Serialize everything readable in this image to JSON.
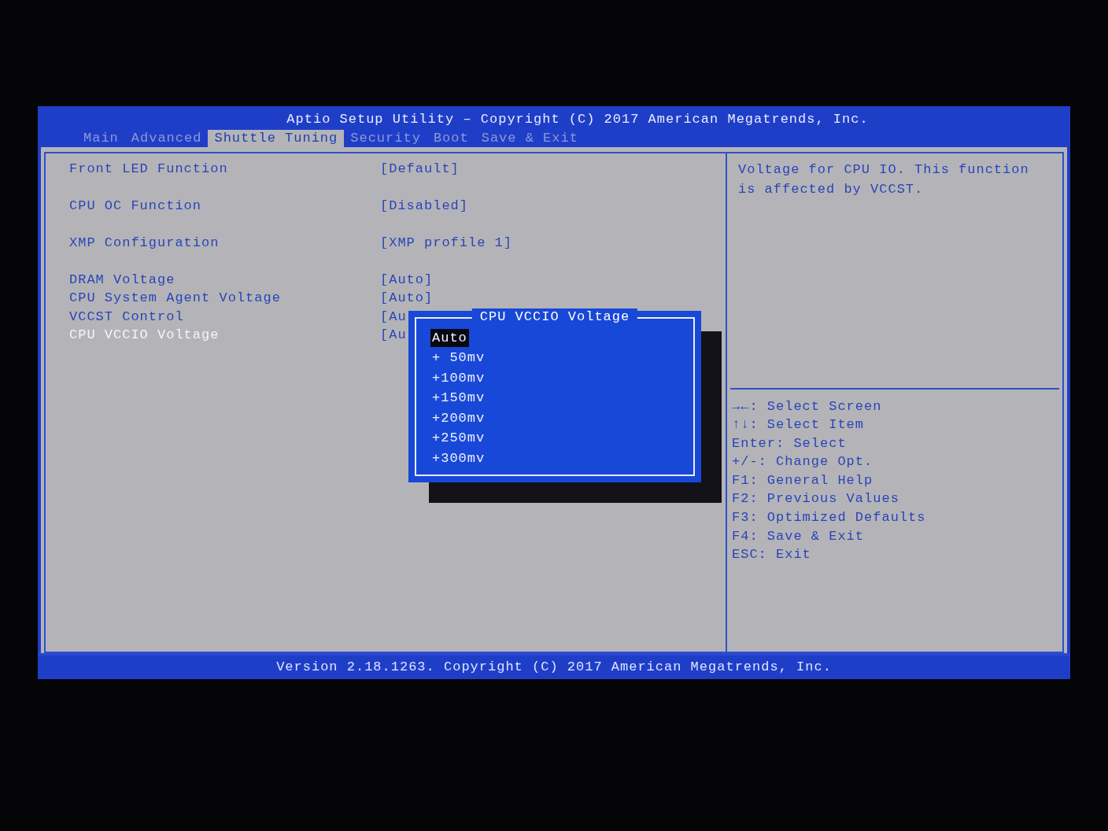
{
  "title": "Aptio Setup Utility – Copyright (C) 2017 American Megatrends, Inc.",
  "tabs": [
    {
      "label": "Main",
      "selected": false
    },
    {
      "label": "Advanced",
      "selected": false
    },
    {
      "label": "Shuttle Tuning",
      "selected": true
    },
    {
      "label": "Security",
      "selected": false
    },
    {
      "label": "Boot",
      "selected": false
    },
    {
      "label": "Save & Exit",
      "selected": false
    }
  ],
  "setting_groups": [
    [
      {
        "label": "Front LED Function",
        "value": "[Default]",
        "selected": false
      }
    ],
    [
      {
        "label": "CPU OC Function",
        "value": "[Disabled]",
        "selected": false
      }
    ],
    [
      {
        "label": "XMP Configuration",
        "value": "[XMP profile 1]",
        "selected": false
      }
    ],
    [
      {
        "label": "DRAM Voltage",
        "value": "[Auto]",
        "selected": false
      },
      {
        "label": "CPU System Agent Voltage",
        "value": "[Auto]",
        "selected": false
      },
      {
        "label": "VCCST Control",
        "value": "[Au",
        "selected": false
      },
      {
        "label": "CPU VCCIO Voltage",
        "value": "[Au",
        "selected": true
      }
    ]
  ],
  "popup": {
    "title": "CPU VCCIO Voltage",
    "options": [
      {
        "label": "Auto",
        "selected": true
      },
      {
        "label": "+ 50mv",
        "selected": false
      },
      {
        "label": "+100mv",
        "selected": false
      },
      {
        "label": "+150mv",
        "selected": false
      },
      {
        "label": "+200mv",
        "selected": false
      },
      {
        "label": "+250mv",
        "selected": false
      },
      {
        "label": "+300mv",
        "selected": false
      }
    ]
  },
  "help": {
    "description": "Voltage for CPU IO. This function is affected by VCCST.",
    "keys": [
      "→←: Select Screen",
      "↑↓: Select Item",
      "Enter: Select",
      "+/-: Change Opt.",
      "F1: General Help",
      "F2: Previous Values",
      "F3: Optimized Defaults",
      "F4: Save & Exit",
      "ESC: Exit"
    ]
  },
  "footer": "Version 2.18.1263. Copyright (C) 2017 American Megatrends, Inc."
}
